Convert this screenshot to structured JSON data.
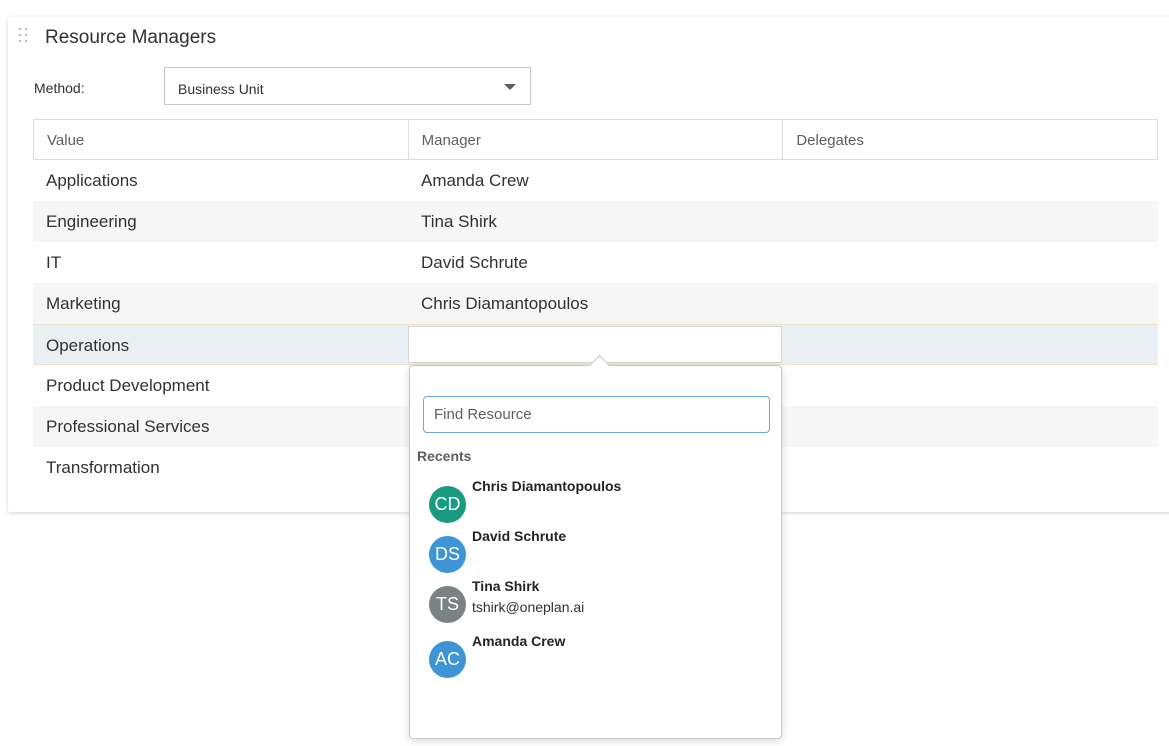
{
  "section": {
    "title": "Resource Managers"
  },
  "method": {
    "label": "Method:",
    "selected": "Business Unit"
  },
  "table": {
    "headers": [
      "Value",
      "Manager",
      "Delegates"
    ],
    "rows": [
      {
        "value": "Applications",
        "manager": "Amanda Crew",
        "delegates": ""
      },
      {
        "value": "Engineering",
        "manager": "Tina Shirk",
        "delegates": ""
      },
      {
        "value": "IT",
        "manager": "David Schrute",
        "delegates": ""
      },
      {
        "value": "Marketing",
        "manager": "Chris Diamantopoulos",
        "delegates": ""
      },
      {
        "value": "Operations",
        "manager": "",
        "delegates": ""
      },
      {
        "value": "Product Development",
        "manager": "",
        "delegates": ""
      },
      {
        "value": "Professional Services",
        "manager": "",
        "delegates": ""
      },
      {
        "value": "Transformation",
        "manager": "",
        "delegates": ""
      }
    ]
  },
  "picker": {
    "search_placeholder": "Find Resource",
    "recents_label": "Recents",
    "recents": [
      {
        "initials": "CD",
        "name": "Chris Diamantopoulos",
        "email": "",
        "color": "#1a9b7f"
      },
      {
        "initials": "DS",
        "name": "David Schrute",
        "email": "",
        "color": "#3e95d5"
      },
      {
        "initials": "TS",
        "name": "Tina Shirk",
        "email": "tshirk@oneplan.ai",
        "color": "#7a8285"
      },
      {
        "initials": "AC",
        "name": "Amanda Crew",
        "email": "",
        "color": "#3e95d5"
      }
    ]
  }
}
